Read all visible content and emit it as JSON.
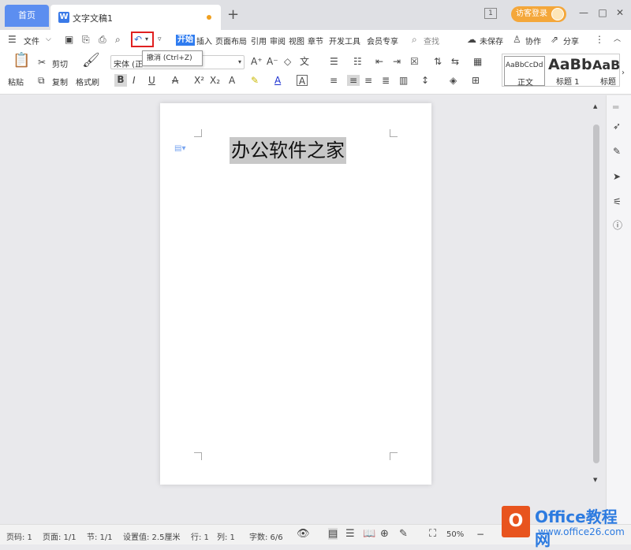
{
  "tabs": {
    "home": "首页",
    "document": "文字文稿1",
    "new_tab": "+"
  },
  "window": {
    "count": "1",
    "login": "访客登录",
    "minimize": "—",
    "maximize": "□",
    "close": "✕"
  },
  "menu": {
    "file": "文件",
    "tabs": [
      "开始",
      "插入",
      "页面布局",
      "引用",
      "审阅",
      "视图",
      "章节",
      "开发工具",
      "会员专享"
    ],
    "search": "查找",
    "unsaved": "未保存",
    "collaborate": "协作",
    "share": "分享"
  },
  "tooltip": "撤消 (Ctrl+Z)",
  "ribbon": {
    "paste": "粘贴",
    "cut": "剪切",
    "copy": "复制",
    "format_painter": "格式刷",
    "font_name": "宋体 (正",
    "styles": [
      {
        "preview": "AaBbCcDd",
        "name": "正文"
      },
      {
        "preview": "AaBb",
        "name": "标题 1"
      },
      {
        "preview": "AaB",
        "name": "标题"
      }
    ]
  },
  "document": {
    "text": "办公软件之家"
  },
  "status": {
    "page": "页码: 1",
    "pages": "页面: 1/1",
    "section": "节: 1/1",
    "setting": "设置值: 2.5厘米",
    "row": "行: 1",
    "col": "列: 1",
    "words": "字数: 6/6",
    "zoom": "50%"
  },
  "watermark": {
    "title": "Office教程网",
    "url": "www.office26.com"
  },
  "colors": {
    "accent": "#2f7cf0",
    "home_tab": "#5c8ef0",
    "highlight": "#e02020",
    "login": "#f4a73a"
  }
}
